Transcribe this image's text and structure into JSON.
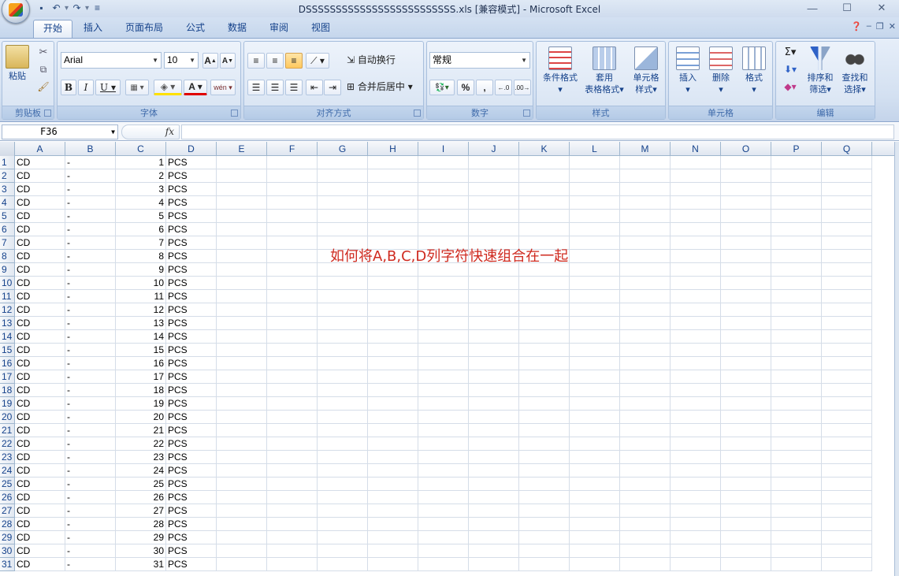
{
  "window": {
    "title": "DSSSSSSSSSSSSSSSSSSSSSSSSS.xls  [兼容模式] - Microsoft Excel"
  },
  "tabs": [
    "开始",
    "插入",
    "页面布局",
    "公式",
    "数据",
    "审阅",
    "视图"
  ],
  "active_tab": "开始",
  "ribbon": {
    "clipboard": {
      "label": "剪贴板",
      "paste": "粘贴"
    },
    "font": {
      "label": "字体",
      "font_name": "Arial",
      "font_size": "10"
    },
    "alignment": {
      "label": "对齐方式",
      "wrap_text": "自动换行",
      "merge_center": "合并后居中"
    },
    "number": {
      "label": "数字",
      "format": "常规",
      "percent": "%",
      "comma": ","
    },
    "styles": {
      "label": "样式",
      "conditional_format_line1": "条件格式",
      "table_format_line1": "套用",
      "table_format_line2": "表格格式",
      "cell_styles_line1": "单元格",
      "cell_styles_line2": "样式"
    },
    "cells": {
      "label": "单元格",
      "insert": "插入",
      "delete": "删除",
      "format": "格式"
    },
    "editing": {
      "label": "编辑",
      "sort_line1": "排序和",
      "sort_line2": "筛选",
      "find_line1": "查找和",
      "find_line2": "选择"
    }
  },
  "formula_bar": {
    "name_box": "F36",
    "formula": ""
  },
  "columns": [
    "A",
    "B",
    "C",
    "D",
    "E",
    "F",
    "G",
    "H",
    "I",
    "J",
    "K",
    "L",
    "M",
    "N",
    "O",
    "P",
    "Q"
  ],
  "rows": [
    {
      "n": "1",
      "a": "CD",
      "b": "-",
      "c": "1",
      "d": "PCS"
    },
    {
      "n": "2",
      "a": "CD",
      "b": "-",
      "c": "2",
      "d": "PCS"
    },
    {
      "n": "3",
      "a": "CD",
      "b": "-",
      "c": "3",
      "d": "PCS"
    },
    {
      "n": "4",
      "a": "CD",
      "b": "-",
      "c": "4",
      "d": "PCS"
    },
    {
      "n": "5",
      "a": "CD",
      "b": "-",
      "c": "5",
      "d": "PCS"
    },
    {
      "n": "6",
      "a": "CD",
      "b": "-",
      "c": "6",
      "d": "PCS"
    },
    {
      "n": "7",
      "a": "CD",
      "b": "-",
      "c": "7",
      "d": "PCS"
    },
    {
      "n": "8",
      "a": "CD",
      "b": "-",
      "c": "8",
      "d": "PCS"
    },
    {
      "n": "9",
      "a": "CD",
      "b": "-",
      "c": "9",
      "d": "PCS"
    },
    {
      "n": "10",
      "a": "CD",
      "b": "-",
      "c": "10",
      "d": "PCS"
    },
    {
      "n": "11",
      "a": "CD",
      "b": "-",
      "c": "11",
      "d": "PCS"
    },
    {
      "n": "12",
      "a": "CD",
      "b": "-",
      "c": "12",
      "d": "PCS"
    },
    {
      "n": "13",
      "a": "CD",
      "b": "-",
      "c": "13",
      "d": "PCS"
    },
    {
      "n": "14",
      "a": "CD",
      "b": "-",
      "c": "14",
      "d": "PCS"
    },
    {
      "n": "15",
      "a": "CD",
      "b": "-",
      "c": "15",
      "d": "PCS"
    },
    {
      "n": "16",
      "a": "CD",
      "b": "-",
      "c": "16",
      "d": "PCS"
    },
    {
      "n": "17",
      "a": "CD",
      "b": "-",
      "c": "17",
      "d": "PCS"
    },
    {
      "n": "18",
      "a": "CD",
      "b": "-",
      "c": "18",
      "d": "PCS"
    },
    {
      "n": "19",
      "a": "CD",
      "b": "-",
      "c": "19",
      "d": "PCS"
    },
    {
      "n": "20",
      "a": "CD",
      "b": "-",
      "c": "20",
      "d": "PCS"
    },
    {
      "n": "21",
      "a": "CD",
      "b": "-",
      "c": "21",
      "d": "PCS"
    },
    {
      "n": "22",
      "a": "CD",
      "b": "-",
      "c": "22",
      "d": "PCS"
    },
    {
      "n": "23",
      "a": "CD",
      "b": "-",
      "c": "23",
      "d": "PCS"
    },
    {
      "n": "24",
      "a": "CD",
      "b": "-",
      "c": "24",
      "d": "PCS"
    },
    {
      "n": "25",
      "a": "CD",
      "b": "-",
      "c": "25",
      "d": "PCS"
    },
    {
      "n": "26",
      "a": "CD",
      "b": "-",
      "c": "26",
      "d": "PCS"
    },
    {
      "n": "27",
      "a": "CD",
      "b": "-",
      "c": "27",
      "d": "PCS"
    },
    {
      "n": "28",
      "a": "CD",
      "b": "-",
      "c": "28",
      "d": "PCS"
    },
    {
      "n": "29",
      "a": "CD",
      "b": "-",
      "c": "29",
      "d": "PCS"
    },
    {
      "n": "30",
      "a": "CD",
      "b": "-",
      "c": "30",
      "d": "PCS"
    },
    {
      "n": "31",
      "a": "CD",
      "b": "-",
      "c": "31",
      "d": "PCS"
    }
  ],
  "annotation": "如何将A,B,C,D列字符快速组合在一起",
  "colors": {
    "annotation": "#cf2a1f",
    "ribbon_text": "#15428b"
  }
}
